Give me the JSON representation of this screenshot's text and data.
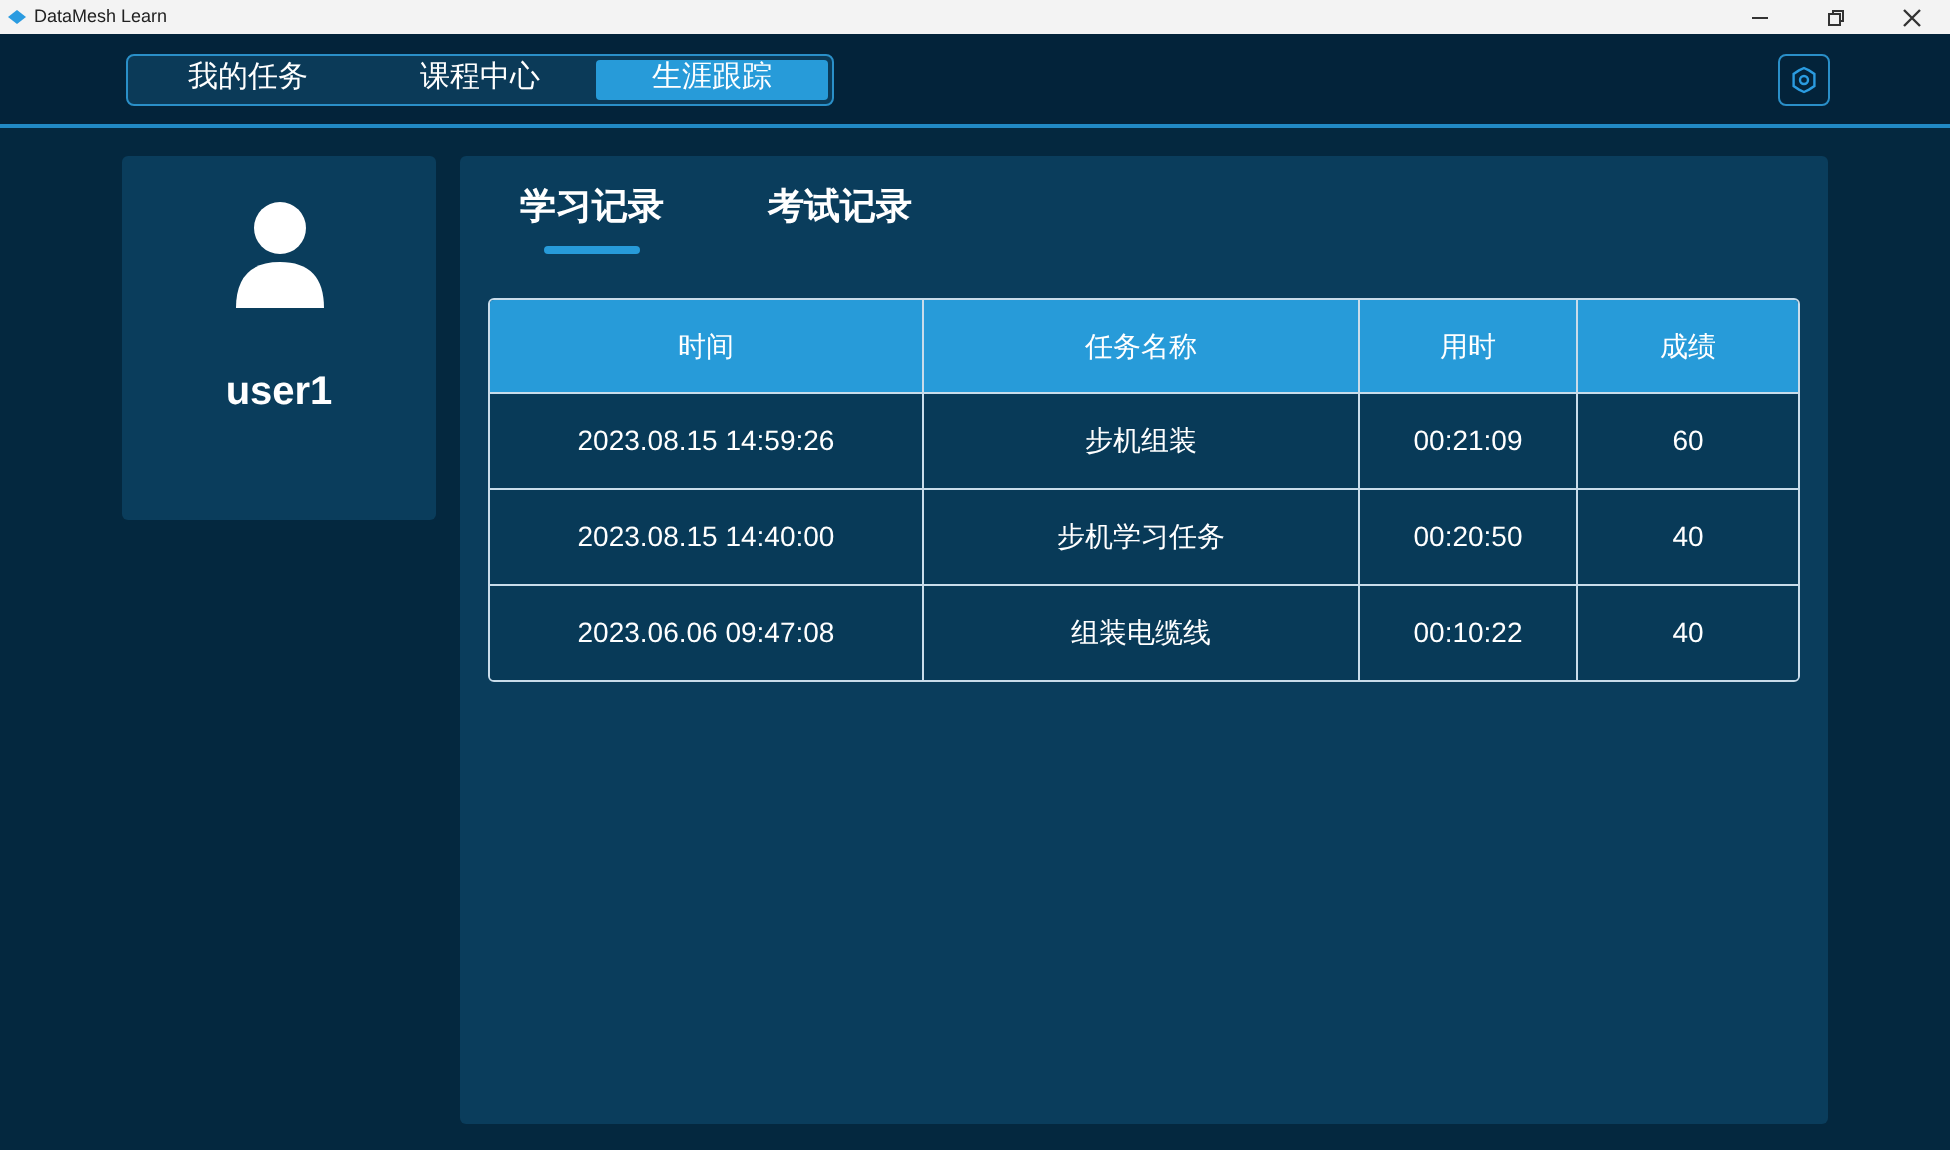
{
  "window": {
    "title": "DataMesh Learn"
  },
  "nav_tabs": [
    {
      "label": "我的任务",
      "selected": false
    },
    {
      "label": "课程中心",
      "selected": false
    },
    {
      "label": "生涯跟踪",
      "selected": true
    }
  ],
  "profile": {
    "username": "user1"
  },
  "record_tabs": [
    {
      "label": "学习记录",
      "selected": true
    },
    {
      "label": "考试记录",
      "selected": false
    }
  ],
  "table": {
    "columns": [
      "时间",
      "任务名称",
      "用时",
      "成绩"
    ],
    "rows": [
      [
        "2023.08.15 14:59:26",
        "步机组装",
        "00:21:09",
        "60"
      ],
      [
        "2023.08.15 14:40:00",
        "步机学习任务",
        "00:20:50",
        "40"
      ],
      [
        "2023.06.06 09:47:08",
        "组装电缆线",
        "00:10:22",
        "40"
      ]
    ]
  }
}
